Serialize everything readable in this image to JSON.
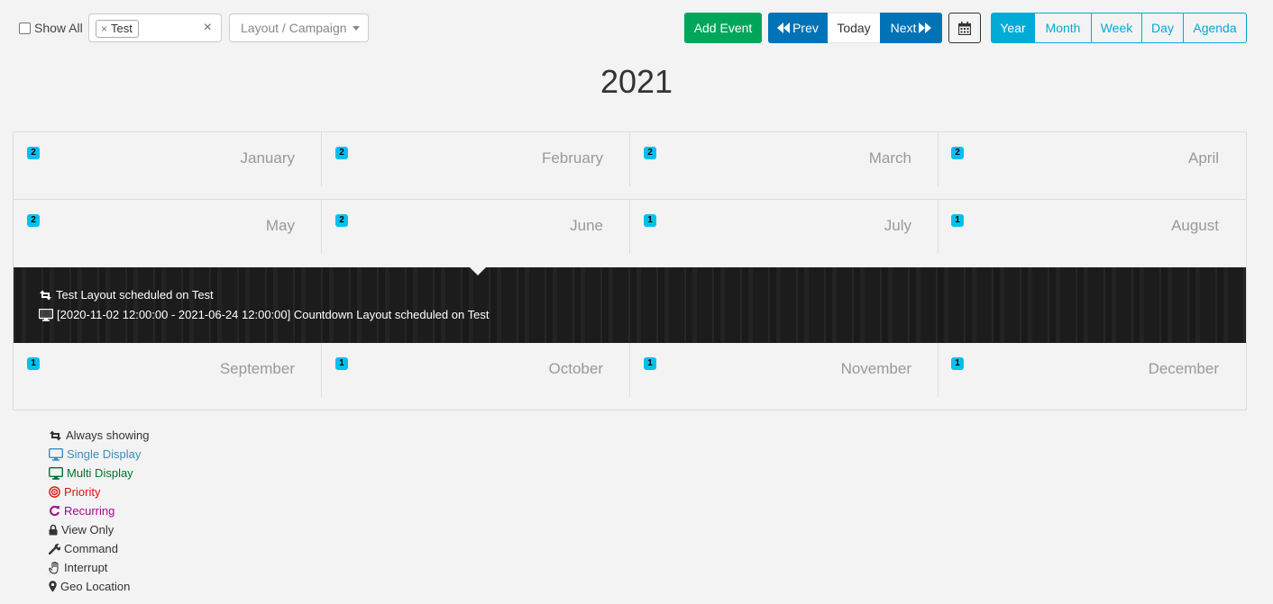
{
  "toolbar": {
    "show_all_label": "Show All",
    "display_tag": "Test",
    "campaign_placeholder": "Layout / Campaign",
    "add_event": "Add Event",
    "prev": "Prev",
    "today": "Today",
    "next": "Next",
    "views": [
      "Year",
      "Month",
      "Week",
      "Day",
      "Agenda"
    ],
    "active_view": "Year"
  },
  "year": "2021",
  "months": [
    {
      "name": "January",
      "count": "2"
    },
    {
      "name": "February",
      "count": "2"
    },
    {
      "name": "March",
      "count": "2"
    },
    {
      "name": "April",
      "count": "2"
    },
    {
      "name": "May",
      "count": "2"
    },
    {
      "name": "June",
      "count": "2"
    },
    {
      "name": "July",
      "count": "1"
    },
    {
      "name": "August",
      "count": "1"
    },
    {
      "name": "September",
      "count": "1"
    },
    {
      "name": "October",
      "count": "1"
    },
    {
      "name": "November",
      "count": "1"
    },
    {
      "name": "December",
      "count": "1"
    }
  ],
  "events": [
    {
      "icon": "retweet-icon",
      "text": "Test Layout scheduled on Test"
    },
    {
      "icon": "desktop-icon",
      "text": "[2020-11-02 12:00:00 - 2021-06-24 12:00:00] Countdown Layout scheduled on Test"
    }
  ],
  "legend": [
    {
      "icon": "retweet-icon",
      "label": "Always showing",
      "color": "#333333"
    },
    {
      "icon": "desktop-icon",
      "label": "Single Display",
      "color": "#3c8dbc"
    },
    {
      "icon": "desktop-icon",
      "label": "Multi Display",
      "color": "#00732e"
    },
    {
      "icon": "bullseye-icon",
      "label": "Priority",
      "color": "#dd1111"
    },
    {
      "icon": "refresh-icon",
      "label": "Recurring",
      "color": "#a00a8c"
    },
    {
      "icon": "lock-icon",
      "label": "View Only",
      "color": "#333333"
    },
    {
      "icon": "wrench-icon",
      "label": "Command",
      "color": "#333333"
    },
    {
      "icon": "hand-icon",
      "label": "Interrupt",
      "color": "#333333"
    },
    {
      "icon": "map-marker-icon",
      "label": "Geo Location",
      "color": "#333333"
    }
  ]
}
